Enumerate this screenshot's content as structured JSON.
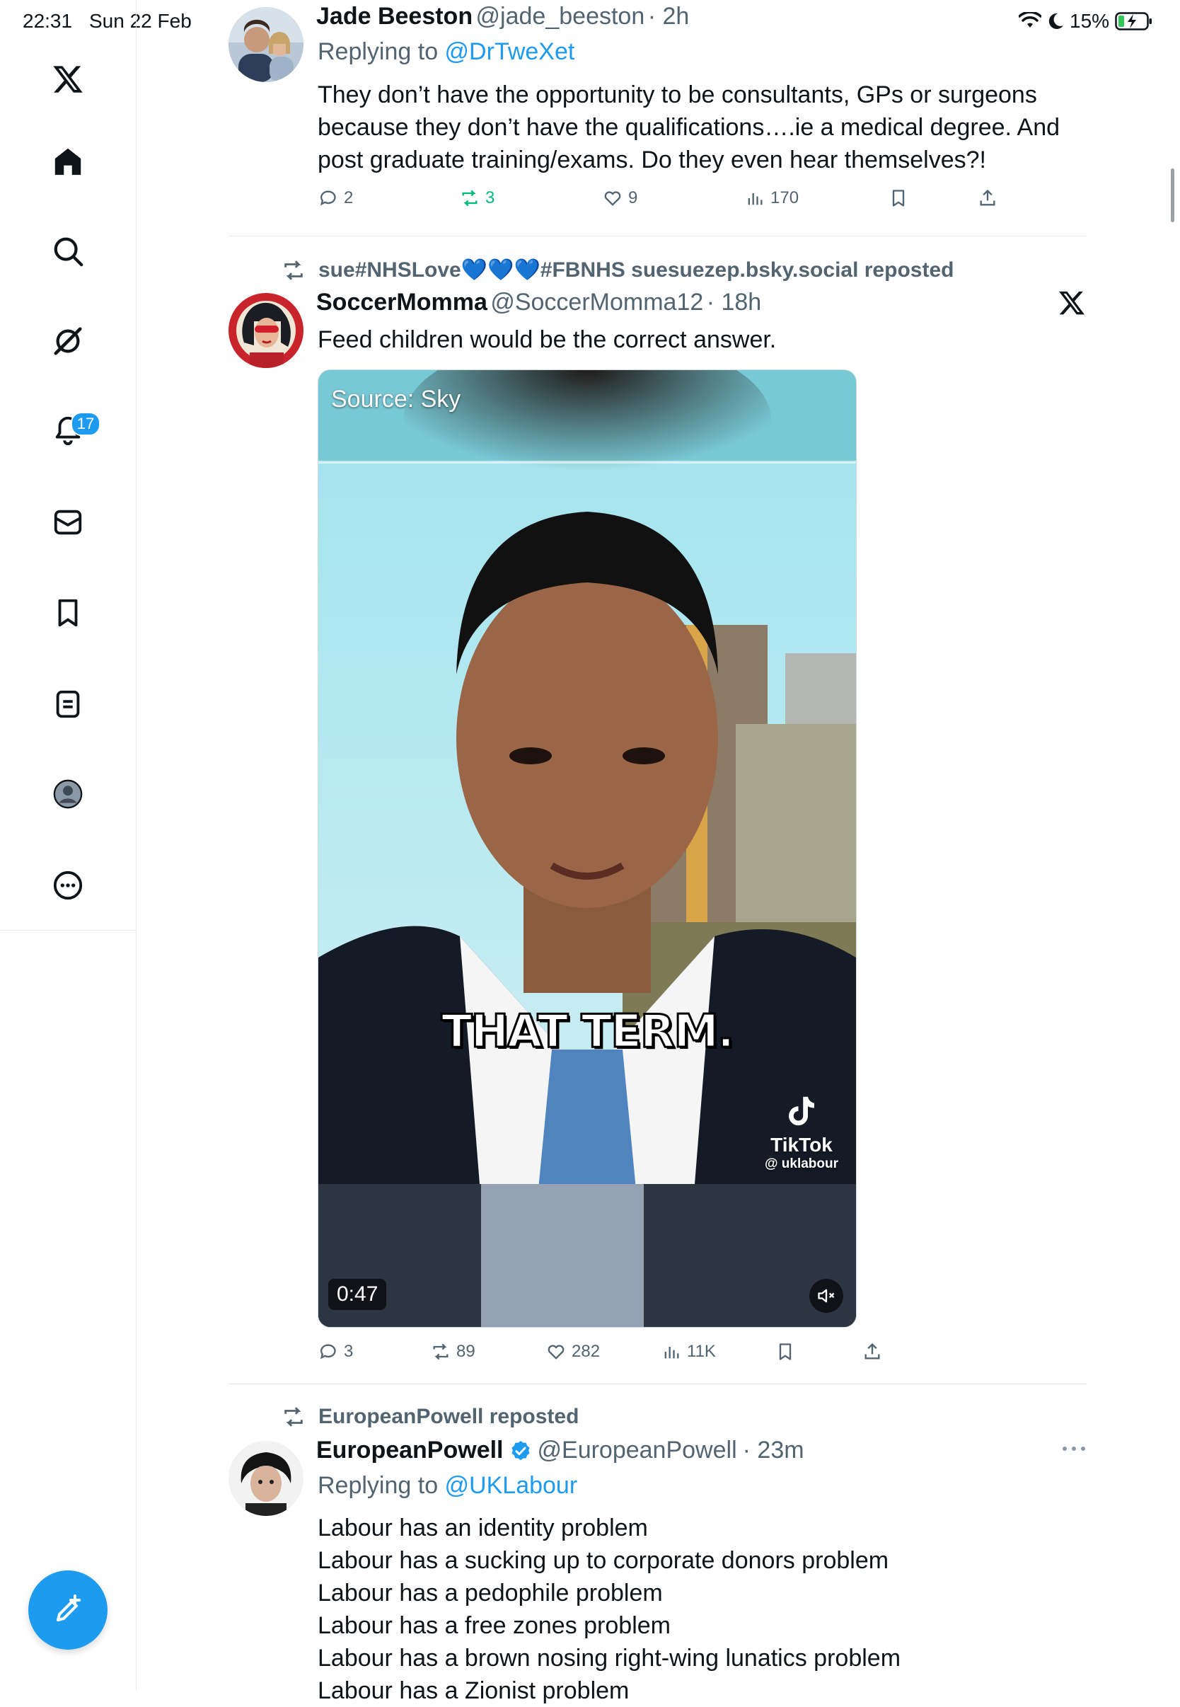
{
  "status_bar": {
    "time": "22:31",
    "date": "Sun 22 Feb",
    "battery": "15%"
  },
  "sidebar": {
    "items": [
      {
        "name": "x-logo-icon"
      },
      {
        "name": "home-icon"
      },
      {
        "name": "search-icon"
      },
      {
        "name": "grok-icon"
      },
      {
        "name": "notifications-icon",
        "badge": "17"
      },
      {
        "name": "messages-icon"
      },
      {
        "name": "bookmarks-icon"
      },
      {
        "name": "lists-icon"
      },
      {
        "name": "profile-icon"
      },
      {
        "name": "more-icon"
      }
    ],
    "compose_icon": "compose-icon"
  },
  "tweets": [
    {
      "display_name": "Jade Beeston",
      "handle": "@jade_beeston",
      "time": "· 2h",
      "replying_prefix": "Replying to ",
      "replying_to": "@DrTweXet",
      "text": "They don’t have the opportunity to be consultants, GPs or surgeons because they don’t have the qualifications….ie a medical degree. And post graduate training/exams. Do they even hear themselves?!",
      "replies": "2",
      "reposts": "3",
      "likes": "9",
      "views": "170"
    },
    {
      "repost_by": "sue#NHSLove💙💙💙#FBNHS suesuezep.bsky.social reposted",
      "display_name": "SoccerMomma",
      "handle": "@SoccerMomma12",
      "time": "· 18h",
      "text": "Feed children would be the correct answer.",
      "video": {
        "source_label": "Source: Sky",
        "caption": "THAT TERM.",
        "watermark_brand": "TikTok",
        "watermark_handle": "@ uklabour",
        "duration": "0:47"
      },
      "replies": "3",
      "reposts": "89",
      "likes": "282",
      "views": "11K"
    },
    {
      "repost_by": "EuropeanPowell reposted",
      "display_name": "EuropeanPowell",
      "handle": "@EuropeanPowell",
      "time": "· 23m",
      "replying_prefix": "Replying to ",
      "replying_to": "@UKLabour",
      "lines": [
        "Labour has an identity problem",
        "Labour has a sucking up to corporate donors problem",
        "Labour has a pedophile problem",
        "Labour has a free zones problem",
        "Labour has a brown nosing right-wing lunatics problem",
        "Labour has a Zionist problem"
      ]
    }
  ],
  "colors": {
    "accent": "#1d9bf0",
    "muted": "#536471",
    "repost_green": "#00ba7c"
  }
}
